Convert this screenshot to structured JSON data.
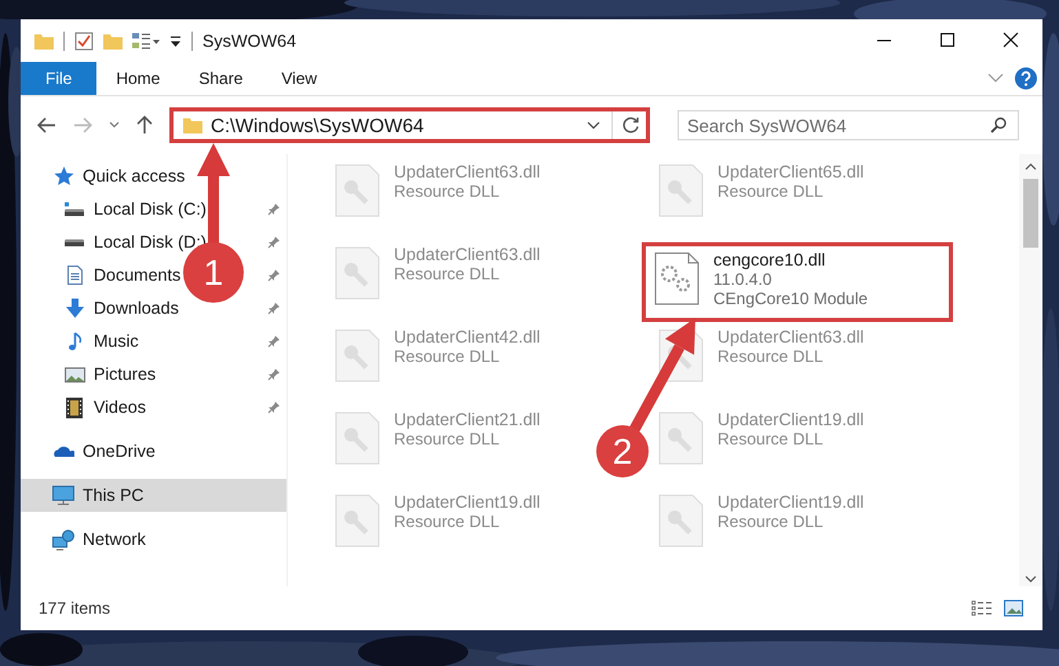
{
  "window": {
    "title": "SysWOW64"
  },
  "ribbon": {
    "tabs": [
      {
        "label": "File",
        "selected": true
      },
      {
        "label": "Home",
        "selected": false
      },
      {
        "label": "Share",
        "selected": false
      },
      {
        "label": "View",
        "selected": false
      }
    ]
  },
  "address_bar": {
    "path": "C:\\Windows\\SysWOW64",
    "highlighted": true
  },
  "search": {
    "placeholder": "Search SysWOW64"
  },
  "sidebar": {
    "items": [
      {
        "label": "Quick access",
        "selected": false,
        "children": [
          {
            "label": "Local Disk (C:)",
            "pinned": true,
            "selected": false
          },
          {
            "label": "Local Disk (D:)",
            "pinned": true,
            "selected": false
          },
          {
            "label": "Documents",
            "pinned": true,
            "selected": false
          },
          {
            "label": "Downloads",
            "pinned": true,
            "selected": false
          },
          {
            "label": "Music",
            "pinned": true,
            "selected": false
          },
          {
            "label": "Pictures",
            "pinned": true,
            "selected": false
          },
          {
            "label": "Videos",
            "pinned": true,
            "selected": false
          }
        ]
      },
      {
        "label": "OneDrive",
        "selected": false
      },
      {
        "label": "This PC",
        "selected": true
      },
      {
        "label": "Network",
        "selected": false
      }
    ]
  },
  "files": [
    {
      "name": "UpdaterClient63.dll",
      "type": "Resource DLL",
      "kind": "blurred"
    },
    {
      "name": "UpdaterClient65.dll",
      "type": "Resource DLL",
      "kind": "blurred"
    },
    {
      "name": "UpdaterClient63.dll",
      "type": "Resource DLL",
      "kind": "blurred"
    },
    {
      "name": "cengcore10.dll",
      "version": "11.0.4.0",
      "type": "CEngCore10 Module",
      "kind": "highlighted"
    },
    {
      "name": "UpdaterClient42.dll",
      "type": "Resource DLL",
      "kind": "blurred"
    },
    {
      "name": "UpdaterClient63.dll",
      "type": "Resource DLL",
      "kind": "blurred"
    },
    {
      "name": "UpdaterClient21.dll",
      "type": "Resource DLL",
      "kind": "blurred"
    },
    {
      "name": "UpdaterClient19.dll",
      "type": "Resource DLL",
      "kind": "blurred"
    },
    {
      "name": "UpdaterClient19.dll",
      "type": "Resource DLL",
      "kind": "blurred"
    },
    {
      "name": "UpdaterClient19.dll",
      "type": "Resource DLL",
      "kind": "blurred"
    }
  ],
  "status_bar": {
    "item_count": "177 items"
  },
  "annotations": [
    {
      "number": "1"
    },
    {
      "number": "2"
    }
  ]
}
